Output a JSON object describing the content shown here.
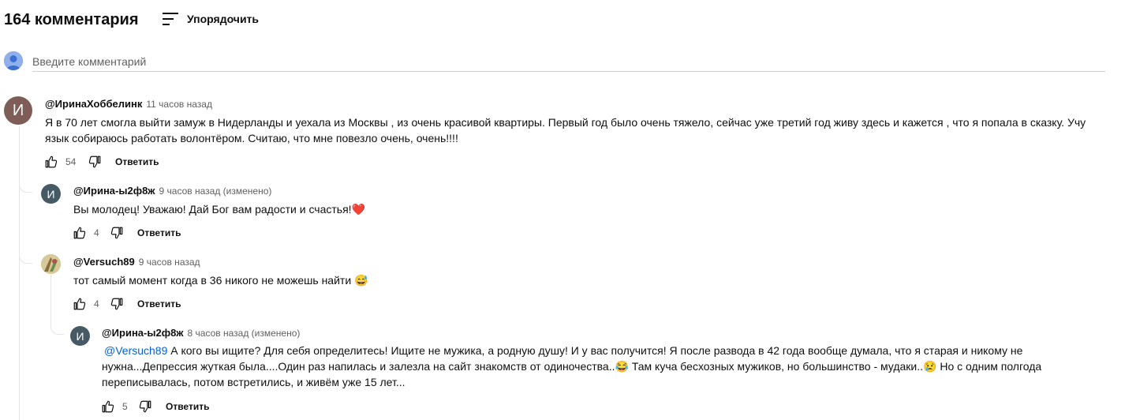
{
  "header": {
    "count_label": "164 комментария",
    "sort_label": "Упорядочить"
  },
  "composer": {
    "placeholder": "Введите комментарий"
  },
  "comments": [
    {
      "author": "@ИринаХоббелинк",
      "time": "11 часов назад",
      "avatar_letter": "И",
      "avatar_color": "#7e5c57",
      "text_lines": [
        "Я в 70 лет смогла выйти замуж в Нидерланды и уехала из Москвы , из очень красивой квартиры. Первый год было очень тяжело, сейчас уже третий год живу здесь и кажется , что я попала в сказку. Учу",
        "язык собираюсь работать волонтёром. Считаю, что мне повезло очень, очень!!!!"
      ],
      "likes": "54",
      "reply_label": "Ответить"
    },
    {
      "author": "@Ирина-ы2ф8ж",
      "time": "9 часов назад (изменено)",
      "avatar_letter": "И",
      "avatar_color": "#455a64",
      "text": "Вы молодец! Уважаю! Дай Бог вам радости и счастья!",
      "emoji": "❤️",
      "likes": "4",
      "reply_label": "Ответить"
    },
    {
      "author": "@Versuch89",
      "time": "9 часов назад",
      "avatar_letter": "",
      "avatar_color": "#c9b98a",
      "text": "тот самый момент когда в 36 никого не можешь найти",
      "emoji": "😅",
      "likes": "4",
      "reply_label": "Ответить"
    },
    {
      "author": "@Ирина-ы2ф8ж",
      "time": "8 часов назад (изменено)",
      "avatar_letter": "И",
      "avatar_color": "#455a64",
      "mention": "@Versuch89",
      "line1": "А кого вы ищите? Для себя определитесь! Ищите не мужика, а родную душу! И у вас получится! Я после развода в 42 года вообще думала, что я старая и никому не",
      "line2a": "нужна...Депрессия жуткая была....Один раз напилась и залезла на сайт знакомств от одиночества..",
      "emoji_a": "😂",
      "line2b": " Там куча бесхозных мужиков, но  большинство - мудаки..",
      "emoji_b": "😢",
      "line2c": " Но с одним полгода",
      "line3": "переписывалась, потом встретились, и живём уже 15  лет...",
      "likes": "5",
      "reply_label": "Ответить"
    }
  ],
  "colors": {
    "link": "#065fd4",
    "secondary_text": "#606060",
    "thread_line": "#e5e5e5"
  }
}
